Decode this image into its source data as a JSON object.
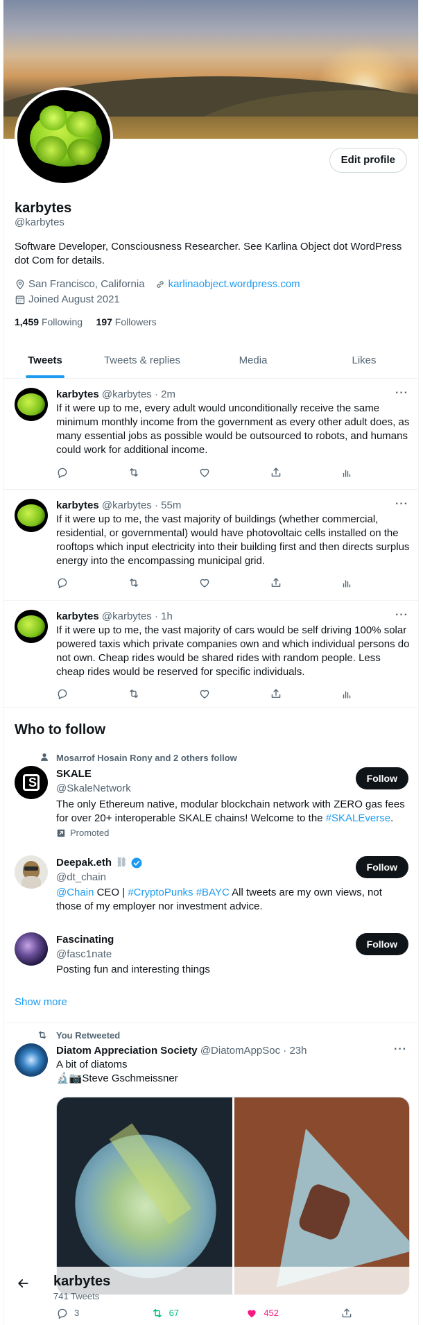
{
  "profile": {
    "name": "karbytes",
    "handle": "@karbytes",
    "edit_label": "Edit profile",
    "bio": "Software Developer, Consciousness Researcher. See Karlina Object dot WordPress dot Com for details.",
    "location": "San Francisco, California",
    "website": "karlinaobject.wordpress.com",
    "joined": "Joined August 2021",
    "following_count": "1,459",
    "following_label": "Following",
    "followers_count": "197",
    "followers_label": "Followers"
  },
  "tabs": [
    "Tweets",
    "Tweets & replies",
    "Media",
    "Likes"
  ],
  "tweets": [
    {
      "name": "karbytes",
      "handle": "@karbytes",
      "time": "2m",
      "text": "If it were up to me, every adult would unconditionally receive the same minimum monthly income from the government as every other adult does, as many essential jobs as possible would be outsourced to robots, and humans could work for additional income."
    },
    {
      "name": "karbytes",
      "handle": "@karbytes",
      "time": "55m",
      "text": "If it were up to me, the vast majority of buildings (whether commercial, residential, or governmental) would have photovoltaic cells installed on the rooftops which input electricity into their building first and then directs surplus energy into the encompassing municipal grid."
    },
    {
      "name": "karbytes",
      "handle": "@karbytes",
      "time": "1h",
      "text": "If it were up to me, the vast majority of cars would be self driving 100% solar powered taxis which private companies own and which individual persons do not own. Cheap rides would be shared rides with random people. Less cheap rides would be reserved for specific individuals."
    }
  ],
  "who_to_follow": {
    "title": "Who to follow",
    "follow_label": "Follow",
    "show_more": "Show more",
    "accounts": [
      {
        "social_context": "Mosarrof Hosain Rony and 2 others follow",
        "name": "SKALE",
        "handle": "@SkaleNetwork",
        "desc_prefix": "The only Ethereum native, modular blockchain network with ZERO gas fees for over 20+ interoperable SKALE chains! Welcome to the ",
        "desc_hashtag": "#SKALEverse",
        "desc_suffix": ".",
        "promoted": "Promoted"
      },
      {
        "name": "Deepak.eth",
        "handle": "@dt_chain",
        "desc_mention": "@Chain",
        "desc_ceo": " CEO | ",
        "desc_tag1": "#CryptoPunks",
        "desc_space": " ",
        "desc_tag2": "#BAYC",
        "desc_rest": " All tweets are my own views, not those of my employer nor investment advice."
      },
      {
        "name": "Fascinating",
        "handle": "@fasc1nate",
        "desc": "Posting fun and interesting things"
      }
    ]
  },
  "retweet": {
    "label": "You Retweeted",
    "name": "Diatom Appreciation Society",
    "handle": "@DiatomAppSoc",
    "time": "23h",
    "line1": "A bit of diatoms",
    "line2": "🔬📷Steve Gschmeissner",
    "replies": "3",
    "retweets": "67",
    "likes": "452"
  },
  "sticky_header": {
    "name": "karbytes",
    "tweet_count": "741 Tweets"
  },
  "colors": {
    "accent": "#1d9bf0",
    "retweet_green": "#00ba7c",
    "like_pink": "#f91880",
    "text_secondary": "#536471"
  }
}
